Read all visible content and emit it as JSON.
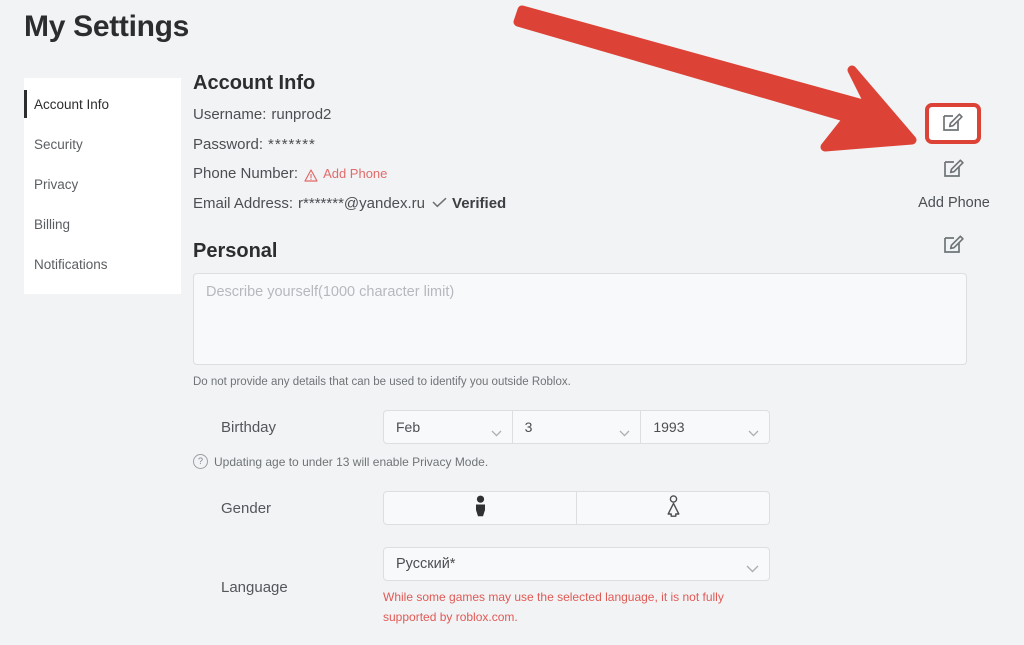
{
  "page": {
    "title": "My Settings",
    "background_color": "#f2f3f5",
    "accent_red": "#dc4236",
    "link_red": "#e16b6b"
  },
  "sidebar": {
    "items": [
      {
        "label": "Account Info",
        "active": true
      },
      {
        "label": "Security",
        "active": false
      },
      {
        "label": "Privacy",
        "active": false
      },
      {
        "label": "Billing",
        "active": false
      },
      {
        "label": "Notifications",
        "active": false
      }
    ]
  },
  "account_info": {
    "heading": "Account Info",
    "username_label": "Username:",
    "username_value": "runprod2",
    "password_label": "Password:",
    "password_value": "*******",
    "phone_label": "Phone Number:",
    "phone_action": "Add Phone",
    "phone_warning_icon": "warning-triangle-icon",
    "email_label": "Email Address:",
    "email_value": "r*******@yandex.ru",
    "email_check_icon": "check-icon",
    "email_status": "Verified"
  },
  "edit_column": {
    "username_edit_icon": "edit-pencil-icon",
    "password_edit_icon": "edit-pencil-icon",
    "phone_edit_icon": "edit-pencil-icon",
    "email_edit_icon": "edit-pencil-icon",
    "add_phone_label": "Add Phone",
    "highlight_border_color": "#dc4236"
  },
  "personal": {
    "heading": "Personal",
    "bio_placeholder": "Describe yourself(1000 character limit)",
    "bio_value": "",
    "bio_note": "Do not provide any details that can be used to identify you outside Roblox."
  },
  "birthday": {
    "label": "Birthday",
    "month": "Feb",
    "day": "3",
    "year": "1993",
    "hint": "Updating age to under 13 will enable Privacy Mode.",
    "hint_icon": "question-circle-icon",
    "chevron_icon": "chevron-down-icon"
  },
  "gender": {
    "label": "Gender",
    "male_icon": "male-figure-icon",
    "female_icon": "female-figure-icon",
    "selected": "male"
  },
  "language": {
    "label": "Language",
    "value": "Русский*",
    "chevron_icon": "chevron-down-icon",
    "note": "While some games may use the selected language, it is not fully supported by roblox.com.",
    "note_color": "#e05a55"
  },
  "annotation": {
    "arrow_icon": "red-arrow-icon",
    "arrow_color": "#dc4236"
  }
}
